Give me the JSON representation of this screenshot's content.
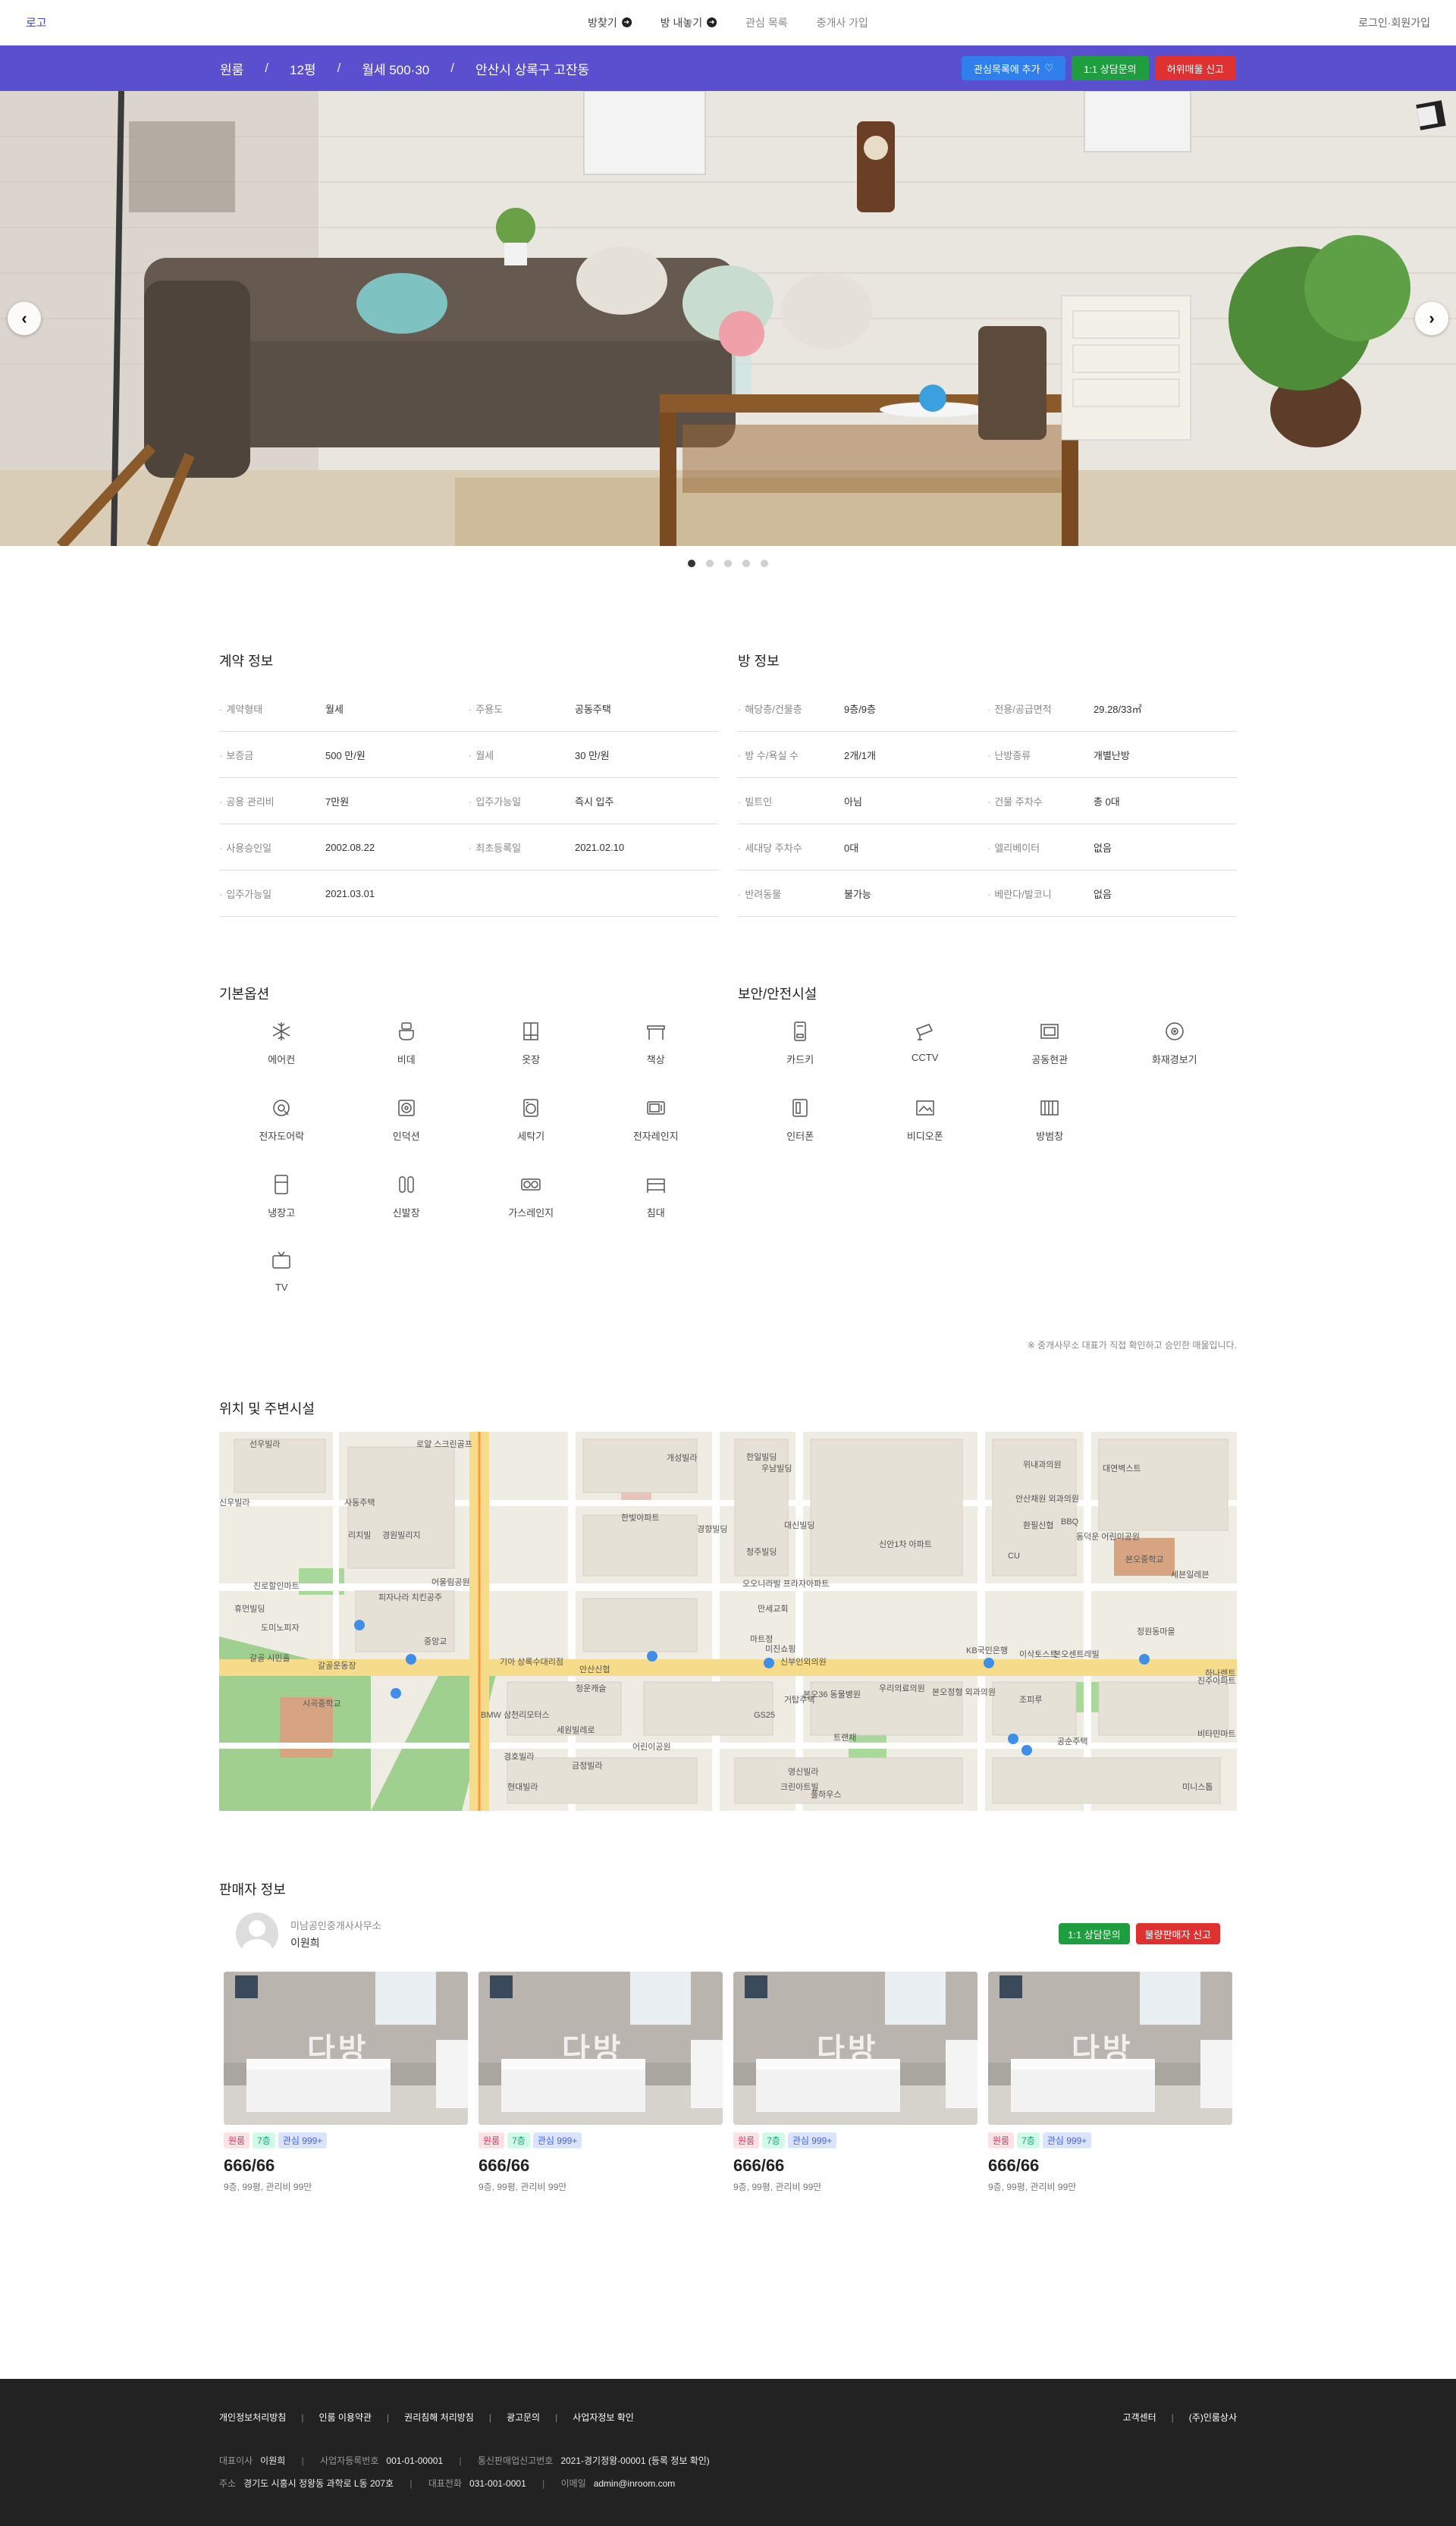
{
  "nav": {
    "logo": "로고",
    "menu": [
      {
        "label": "방찾기",
        "icon": "arrow-right-circle-icon"
      },
      {
        "label": "방 내놓기",
        "icon": "arrow-right-circle-icon"
      },
      {
        "label": "관심 목록"
      },
      {
        "label": "중개사 가입"
      }
    ],
    "auth": "로그인·회원가입"
  },
  "breadcrumb": {
    "items": [
      "원룸",
      "12평",
      "월세 500·30",
      "안산시 상록구 고잔동"
    ],
    "separator": "/"
  },
  "actions": {
    "favorite": "관심목록에 추가",
    "consult": "1:1 상담문의",
    "report": "허위매물 신고"
  },
  "carousel": {
    "slide_count": 5,
    "active_index": 0
  },
  "contract": {
    "title": "계약 정보",
    "rows": [
      [
        {
          "k": "계약형태",
          "v": "월세"
        },
        {
          "k": "주용도",
          "v": "공동주택"
        }
      ],
      [
        {
          "k": "보증금",
          "v": "500 만/원"
        },
        {
          "k": "월세",
          "v": "30 만/원"
        }
      ],
      [
        {
          "k": "공용 관리비",
          "v": "7만원"
        },
        {
          "k": "입주가능일",
          "v": "즉시 입주"
        }
      ],
      [
        {
          "k": "사용승인일",
          "v": "2002.08.22"
        },
        {
          "k": "최초등록일",
          "v": "2021.02.10"
        }
      ],
      [
        {
          "k": "입주가능일",
          "v": "2021.03.01"
        },
        {
          "k": "",
          "v": ""
        }
      ]
    ]
  },
  "room": {
    "title": "방 정보",
    "rows": [
      [
        {
          "k": "해당층/건물층",
          "v": "9층/9층"
        },
        {
          "k": "전용/공급면적",
          "v": "29.28/33㎡"
        }
      ],
      [
        {
          "k": "방 수/욕실 수",
          "v": "2개/1개"
        },
        {
          "k": "난방종류",
          "v": "개별난방"
        }
      ],
      [
        {
          "k": "빌트인",
          "v": "아님"
        },
        {
          "k": "건물 주차수",
          "v": "총 0대"
        }
      ],
      [
        {
          "k": "세대당 주차수",
          "v": "0대"
        },
        {
          "k": "엘리베이터",
          "v": "없음"
        }
      ],
      [
        {
          "k": "반려동물",
          "v": "불가능"
        },
        {
          "k": "베란다/발코니",
          "v": "없음"
        }
      ]
    ]
  },
  "options": {
    "title": "기본옵션",
    "items": [
      {
        "label": "에어컨",
        "icon": "snowflake-icon"
      },
      {
        "label": "비데",
        "icon": "bidet-icon"
      },
      {
        "label": "옷장",
        "icon": "wardrobe-icon"
      },
      {
        "label": "책상",
        "icon": "desk-icon"
      },
      {
        "label": "전자도어락",
        "icon": "door-lock-icon"
      },
      {
        "label": "인덕션",
        "icon": "induction-icon"
      },
      {
        "label": "세탁기",
        "icon": "washer-icon"
      },
      {
        "label": "전자레인지",
        "icon": "microwave-icon"
      },
      {
        "label": "냉장고",
        "icon": "fridge-icon"
      },
      {
        "label": "신발장",
        "icon": "shoe-rack-icon"
      },
      {
        "label": "가스레인지",
        "icon": "gas-range-icon"
      },
      {
        "label": "침대",
        "icon": "bed-icon"
      },
      {
        "label": "TV",
        "icon": "tv-icon"
      }
    ]
  },
  "security": {
    "title": "보안/안전시설",
    "items": [
      {
        "label": "카드키",
        "icon": "card-key-icon"
      },
      {
        "label": "CCTV",
        "icon": "cctv-icon"
      },
      {
        "label": "공동현관",
        "icon": "entrance-icon"
      },
      {
        "label": "화재경보기",
        "icon": "fire-alarm-icon"
      },
      {
        "label": "인터폰",
        "icon": "intercom-icon"
      },
      {
        "label": "비디오폰",
        "icon": "videophone-icon"
      },
      {
        "label": "방범창",
        "icon": "window-guard-icon"
      }
    ]
  },
  "notice": "※ 중개사무소 대표가 직접 확인하고 승인한 매물입니다.",
  "map": {
    "title": "위치 및 주변시설",
    "labels": [
      "선우빌라",
      "로얄 스크린골프",
      "신우빌라",
      "사동주택",
      "리치빌",
      "경원빌리지",
      "진로할인마트",
      "휴먼빌딩",
      "도미노피자",
      "어울림공원",
      "피자나라 치킨공주",
      "중앙교",
      "갈골 시민홀",
      "갈골운동장",
      "시곡중학교",
      "BMW 삼천리모터스",
      "세원빌레로",
      "경호빌라",
      "금정빌라",
      "현대빌라",
      "기아 상록수대리점",
      "안산신협",
      "청운캐슬",
      "어린이공원",
      "개성빌라",
      "대신빌딩",
      "청주빌딩",
      "우남빌딩",
      "한빛아파트",
      "한일빌딩",
      "경향빌딩",
      "오오니라빌 프라자아파트",
      "신안1차 아파트",
      "만세교회",
      "마트정",
      "미진쇼핑",
      "신부인외의원",
      "본오36 동물병원",
      "우리의료의원",
      "본오정형 외과의원",
      "GS25",
      "거탑주택",
      "트랜채",
      "영신빌라",
      "크린아트빌",
      "풀하우스",
      "위내과의원",
      "대연벽스트",
      "안산채원 외과의원",
      "환필신협",
      "동덕운 어린이공원",
      "KB국민은행",
      "이삭토스트",
      "본오센트레빌",
      "본오중학교",
      "세븐일레븐",
      "정원동마을",
      "조피루",
      "BBQ",
      "CU",
      "진주아파트",
      "하나렌트",
      "비타민마트",
      "공순주택",
      "미니스톱"
    ]
  },
  "seller": {
    "title": "판매자 정보",
    "company": "미남공인중개사사무소",
    "name": "이원희",
    "consult": "1:1 상담문의",
    "report": "불량판매자 신고",
    "listings": [
      {
        "tags": [
          "원룸",
          "7층",
          "관심 999+"
        ],
        "price": "666/66",
        "sub": "9층, 99평, 관리비 99만",
        "watermark": "다방"
      },
      {
        "tags": [
          "원룸",
          "7층",
          "관심 999+"
        ],
        "price": "666/66",
        "sub": "9층, 99평, 관리비 99만",
        "watermark": "다방"
      },
      {
        "tags": [
          "원룸",
          "7층",
          "관심 999+"
        ],
        "price": "666/66",
        "sub": "9층, 99평, 관리비 99만",
        "watermark": "다방"
      },
      {
        "tags": [
          "원룸",
          "7층",
          "관심 999+"
        ],
        "price": "666/66",
        "sub": "9층, 99평, 관리비 99만",
        "watermark": "다방"
      }
    ]
  },
  "footer": {
    "links": [
      "개인정보처리방침",
      "인룸 이용약관",
      "권리침해 처리방침",
      "광고문의",
      "사업자정보 확인"
    ],
    "right_links": [
      "고객센터",
      "(주)인룸상사"
    ],
    "info": {
      "ceo_label": "대표이사",
      "ceo": "이원희",
      "biz_label": "사업자등록번호",
      "biz": "001-01-00001",
      "mail_order_label": "통신판매업신고번호",
      "mail_order": "2021-경기정왕-00001 (등록 정보 확인)",
      "addr_label": "주소",
      "addr": "경기도 시흥시 정왕동 과학로 L동 207호",
      "tel_label": "대표전화",
      "tel": "031-001-0001",
      "email_label": "이메일",
      "email": "admin@inroom.com"
    }
  },
  "colors": {
    "purple_bar": "#5a50cf",
    "blue_button": "#2f80ed",
    "green_button": "#1e9e3e",
    "red_button": "#e03131",
    "footer_bg": "#222222"
  }
}
